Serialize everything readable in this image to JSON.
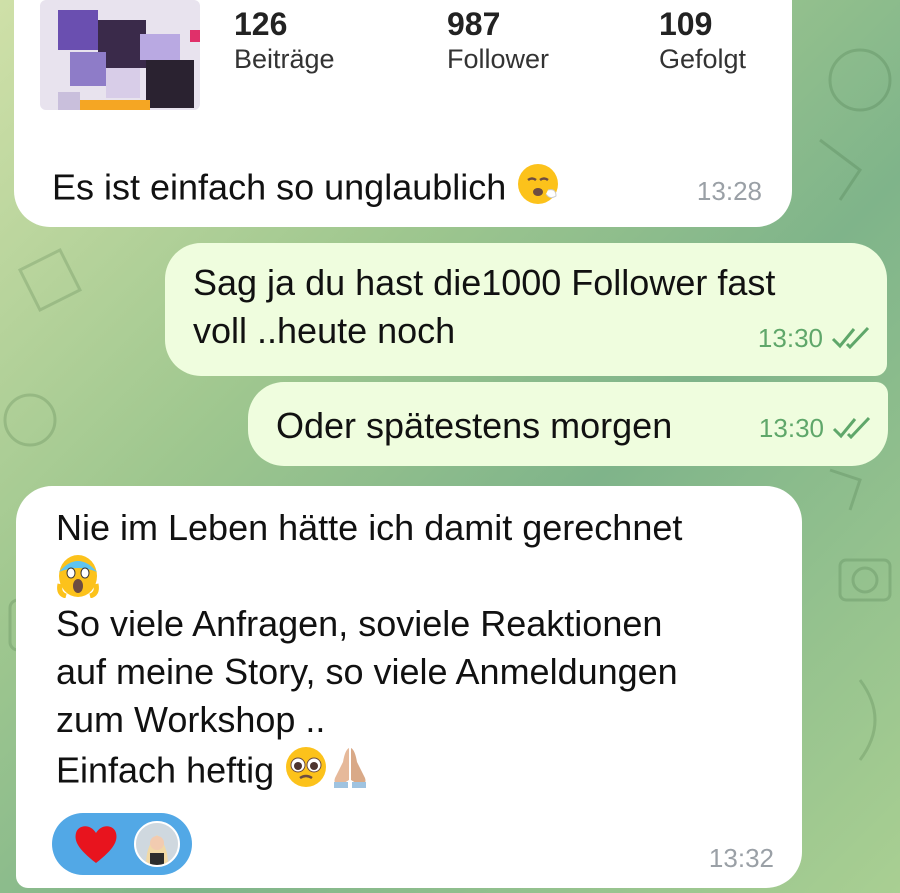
{
  "profile_card": {
    "stats": [
      {
        "value": "126",
        "label": "Beiträge"
      },
      {
        "value": "987",
        "label": "Follower"
      },
      {
        "value": "109",
        "label": "Gefolgt"
      }
    ]
  },
  "messages": [
    {
      "direction": "incoming",
      "lines": [
        "Es ist einfach so unglaublich"
      ],
      "emoji": "exhausted-face",
      "time": "13:28"
    },
    {
      "direction": "outgoing",
      "lines": [
        "Sag ja du hast die1000 Follower fast",
        "voll ..heute noch"
      ],
      "time": "13:30",
      "read": true
    },
    {
      "direction": "outgoing",
      "lines": [
        "Oder spätestens morgen"
      ],
      "time": "13:30",
      "read": true
    },
    {
      "direction": "incoming",
      "lines": [
        "Nie im Leben hätte ich damit gerechnet",
        "So viele Anfragen, soviele Reaktionen",
        "auf meine Story, so viele Anmeldungen",
        "zum Workshop ..",
        "Einfach heftig"
      ],
      "time": "13:32",
      "reactions": [
        "red-heart",
        "user-avatar"
      ]
    }
  ],
  "colors": {
    "incoming_bubble": "#ffffff",
    "outgoing_bubble": "#effdde",
    "check_color": "#5fa76a",
    "reaction_pill": "#52a8e6"
  }
}
